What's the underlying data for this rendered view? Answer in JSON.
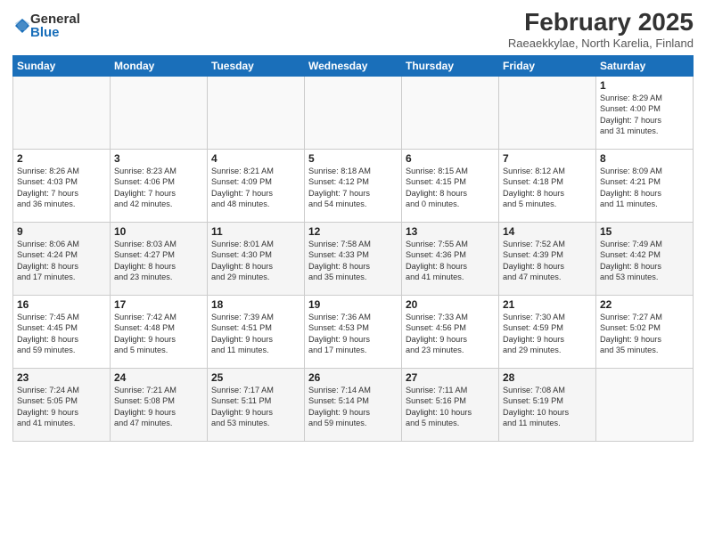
{
  "logo": {
    "general": "General",
    "blue": "Blue"
  },
  "title": "February 2025",
  "subtitle": "Raeaekkylae, North Karelia, Finland",
  "headers": [
    "Sunday",
    "Monday",
    "Tuesday",
    "Wednesday",
    "Thursday",
    "Friday",
    "Saturday"
  ],
  "weeks": [
    [
      {
        "day": "",
        "info": ""
      },
      {
        "day": "",
        "info": ""
      },
      {
        "day": "",
        "info": ""
      },
      {
        "day": "",
        "info": ""
      },
      {
        "day": "",
        "info": ""
      },
      {
        "day": "",
        "info": ""
      },
      {
        "day": "1",
        "info": "Sunrise: 8:29 AM\nSunset: 4:00 PM\nDaylight: 7 hours\nand 31 minutes."
      }
    ],
    [
      {
        "day": "2",
        "info": "Sunrise: 8:26 AM\nSunset: 4:03 PM\nDaylight: 7 hours\nand 36 minutes."
      },
      {
        "day": "3",
        "info": "Sunrise: 8:23 AM\nSunset: 4:06 PM\nDaylight: 7 hours\nand 42 minutes."
      },
      {
        "day": "4",
        "info": "Sunrise: 8:21 AM\nSunset: 4:09 PM\nDaylight: 7 hours\nand 48 minutes."
      },
      {
        "day": "5",
        "info": "Sunrise: 8:18 AM\nSunset: 4:12 PM\nDaylight: 7 hours\nand 54 minutes."
      },
      {
        "day": "6",
        "info": "Sunrise: 8:15 AM\nSunset: 4:15 PM\nDaylight: 8 hours\nand 0 minutes."
      },
      {
        "day": "7",
        "info": "Sunrise: 8:12 AM\nSunset: 4:18 PM\nDaylight: 8 hours\nand 5 minutes."
      },
      {
        "day": "8",
        "info": "Sunrise: 8:09 AM\nSunset: 4:21 PM\nDaylight: 8 hours\nand 11 minutes."
      }
    ],
    [
      {
        "day": "9",
        "info": "Sunrise: 8:06 AM\nSunset: 4:24 PM\nDaylight: 8 hours\nand 17 minutes."
      },
      {
        "day": "10",
        "info": "Sunrise: 8:03 AM\nSunset: 4:27 PM\nDaylight: 8 hours\nand 23 minutes."
      },
      {
        "day": "11",
        "info": "Sunrise: 8:01 AM\nSunset: 4:30 PM\nDaylight: 8 hours\nand 29 minutes."
      },
      {
        "day": "12",
        "info": "Sunrise: 7:58 AM\nSunset: 4:33 PM\nDaylight: 8 hours\nand 35 minutes."
      },
      {
        "day": "13",
        "info": "Sunrise: 7:55 AM\nSunset: 4:36 PM\nDaylight: 8 hours\nand 41 minutes."
      },
      {
        "day": "14",
        "info": "Sunrise: 7:52 AM\nSunset: 4:39 PM\nDaylight: 8 hours\nand 47 minutes."
      },
      {
        "day": "15",
        "info": "Sunrise: 7:49 AM\nSunset: 4:42 PM\nDaylight: 8 hours\nand 53 minutes."
      }
    ],
    [
      {
        "day": "16",
        "info": "Sunrise: 7:45 AM\nSunset: 4:45 PM\nDaylight: 8 hours\nand 59 minutes."
      },
      {
        "day": "17",
        "info": "Sunrise: 7:42 AM\nSunset: 4:48 PM\nDaylight: 9 hours\nand 5 minutes."
      },
      {
        "day": "18",
        "info": "Sunrise: 7:39 AM\nSunset: 4:51 PM\nDaylight: 9 hours\nand 11 minutes."
      },
      {
        "day": "19",
        "info": "Sunrise: 7:36 AM\nSunset: 4:53 PM\nDaylight: 9 hours\nand 17 minutes."
      },
      {
        "day": "20",
        "info": "Sunrise: 7:33 AM\nSunset: 4:56 PM\nDaylight: 9 hours\nand 23 minutes."
      },
      {
        "day": "21",
        "info": "Sunrise: 7:30 AM\nSunset: 4:59 PM\nDaylight: 9 hours\nand 29 minutes."
      },
      {
        "day": "22",
        "info": "Sunrise: 7:27 AM\nSunset: 5:02 PM\nDaylight: 9 hours\nand 35 minutes."
      }
    ],
    [
      {
        "day": "23",
        "info": "Sunrise: 7:24 AM\nSunset: 5:05 PM\nDaylight: 9 hours\nand 41 minutes."
      },
      {
        "day": "24",
        "info": "Sunrise: 7:21 AM\nSunset: 5:08 PM\nDaylight: 9 hours\nand 47 minutes."
      },
      {
        "day": "25",
        "info": "Sunrise: 7:17 AM\nSunset: 5:11 PM\nDaylight: 9 hours\nand 53 minutes."
      },
      {
        "day": "26",
        "info": "Sunrise: 7:14 AM\nSunset: 5:14 PM\nDaylight: 9 hours\nand 59 minutes."
      },
      {
        "day": "27",
        "info": "Sunrise: 7:11 AM\nSunset: 5:16 PM\nDaylight: 10 hours\nand 5 minutes."
      },
      {
        "day": "28",
        "info": "Sunrise: 7:08 AM\nSunset: 5:19 PM\nDaylight: 10 hours\nand 11 minutes."
      },
      {
        "day": "",
        "info": ""
      }
    ]
  ]
}
